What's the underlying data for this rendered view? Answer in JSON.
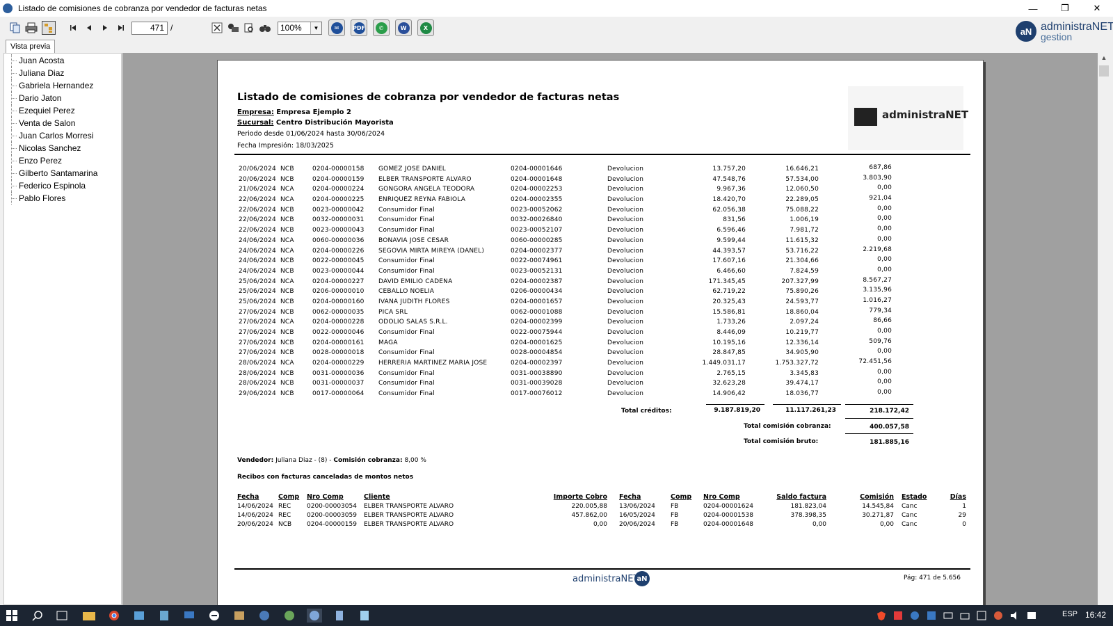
{
  "window": {
    "title": "Listado de comisiones de cobranza por vendedor de facturas netas",
    "minimize": "—",
    "restore": "❐",
    "close": "✕"
  },
  "toolbar": {
    "page_current": "471",
    "page_separator": "/",
    "zoom": "100%",
    "zoom_options": [
      "100%"
    ]
  },
  "brand": {
    "name": "administraNET",
    "sub": "gestion",
    "mark": "aN"
  },
  "tab": {
    "label": "Vista previa"
  },
  "tree": {
    "items": [
      "Juan Acosta",
      "Juliana Diaz",
      "Gabriela Hernandez",
      "Dario Jaton",
      "Ezequiel Perez",
      "Venta de Salon",
      "Juan Carlos Morresi",
      "Nicolas Sanchez",
      "Enzo Perez",
      "Gilberto Santamarina",
      "Federico Espinola",
      "Pablo Flores"
    ]
  },
  "report": {
    "title": "Listado de comisiones de cobranza por vendedor de facturas netas",
    "empresa_label": "Empresa:",
    "empresa_value": " Empresa Ejemplo 2",
    "sucursal_label": "Sucursal:",
    "sucursal_value": " Centro Distribución Mayorista",
    "periodo": "Periodo desde  01/06/2024 hasta 30/06/2024",
    "fecha_impresion": "Fecha Impresión: 18/03/2025",
    "logo_text": "administraNET",
    "rows": [
      [
        "20/06/2024",
        "NCB",
        "0204-00000158",
        "GOMEZ JOSE DANIEL",
        "0204-00001646",
        "Devolucion",
        "13.757,20",
        "16.646,21",
        "687,86"
      ],
      [
        "20/06/2024",
        "NCB",
        "0204-00000159",
        "ELBER TRANSPORTE ALVARO",
        "0204-00001648",
        "Devolucion",
        "47.548,76",
        "57.534,00",
        "3.803,90"
      ],
      [
        "21/06/2024",
        "NCA",
        "0204-00000224",
        "GONGORA ANGELA TEODORA",
        "0204-00002253",
        "Devolucion",
        "9.967,36",
        "12.060,50",
        "0,00"
      ],
      [
        "22/06/2024",
        "NCA",
        "0204-00000225",
        "ENRIQUEZ REYNA FABIOLA",
        "0204-00002355",
        "Devolucion",
        "18.420,70",
        "22.289,05",
        "921,04"
      ],
      [
        "22/06/2024",
        "NCB",
        "0023-00000042",
        "Consumidor Final",
        "0023-00052062",
        "Devolucion",
        "62.056,38",
        "75.088,22",
        "0,00"
      ],
      [
        "22/06/2024",
        "NCB",
        "0032-00000031",
        "Consumidor Final",
        "0032-00026840",
        "Devolucion",
        "831,56",
        "1.006,19",
        "0,00"
      ],
      [
        "22/06/2024",
        "NCB",
        "0023-00000043",
        "Consumidor Final",
        "0023-00052107",
        "Devolucion",
        "6.596,46",
        "7.981,72",
        "0,00"
      ],
      [
        "24/06/2024",
        "NCA",
        "0060-00000036",
        "BONAVIA JOSE CESAR",
        "0060-00000285",
        "Devolucion",
        "9.599,44",
        "11.615,32",
        "0,00"
      ],
      [
        "24/06/2024",
        "NCA",
        "0204-00000226",
        "SEGOVIA MIRTA MIREYA (DANEL)",
        "0204-00002377",
        "Devolucion",
        "44.393,57",
        "53.716,22",
        "2.219,68"
      ],
      [
        "24/06/2024",
        "NCB",
        "0022-00000045",
        "Consumidor Final",
        "0022-00074961",
        "Devolucion",
        "17.607,16",
        "21.304,66",
        "0,00"
      ],
      [
        "24/06/2024",
        "NCB",
        "0023-00000044",
        "Consumidor Final",
        "0023-00052131",
        "Devolucion",
        "6.466,60",
        "7.824,59",
        "0,00"
      ],
      [
        "25/06/2024",
        "NCA",
        "0204-00000227",
        "DAVID EMILIO CADENA",
        "0204-00002387",
        "Devolucion",
        "171.345,45",
        "207.327,99",
        "8.567,27"
      ],
      [
        "25/06/2024",
        "NCB",
        "0206-00000010",
        "CEBALLO NOELIA",
        "0206-00000434",
        "Devolucion",
        "62.719,22",
        "75.890,26",
        "3.135,96"
      ],
      [
        "25/06/2024",
        "NCB",
        "0204-00000160",
        "IVANA JUDITH FLORES",
        "0204-00001657",
        "Devolucion",
        "20.325,43",
        "24.593,77",
        "1.016,27"
      ],
      [
        "27/06/2024",
        "NCB",
        "0062-00000035",
        "PICA SRL",
        "0062-00001088",
        "Devolucion",
        "15.586,81",
        "18.860,04",
        "779,34"
      ],
      [
        "27/06/2024",
        "NCA",
        "0204-00000228",
        "ODOLIO SALAS S.R.L.",
        "0204-00002399",
        "Devolucion",
        "1.733,26",
        "2.097,24",
        "86,66"
      ],
      [
        "27/06/2024",
        "NCB",
        "0022-00000046",
        "Consumidor Final",
        "0022-00075944",
        "Devolucion",
        "8.446,09",
        "10.219,77",
        "0,00"
      ],
      [
        "27/06/2024",
        "NCB",
        "0204-00000161",
        "MAGA",
        "0204-00001625",
        "Devolucion",
        "10.195,16",
        "12.336,14",
        "509,76"
      ],
      [
        "27/06/2024",
        "NCB",
        "0028-00000018",
        "Consumidor Final",
        "0028-00004854",
        "Devolucion",
        "28.847,85",
        "34.905,90",
        "0,00"
      ],
      [
        "28/06/2024",
        "NCA",
        "0204-00000229",
        "HERRERIA MARTINEZ MARIA JOSE",
        "0204-00002397",
        "Devolucion",
        "1.449.031,17",
        "1.753.327,72",
        "72.451,56"
      ],
      [
        "28/06/2024",
        "NCB",
        "0031-00000036",
        "Consumidor Final",
        "0031-00038890",
        "Devolucion",
        "2.765,15",
        "3.345,83",
        "0,00"
      ],
      [
        "28/06/2024",
        "NCB",
        "0031-00000037",
        "Consumidor Final",
        "0031-00039028",
        "Devolucion",
        "32.623,28",
        "39.474,17",
        "0,00"
      ],
      [
        "29/06/2024",
        "NCB",
        "0017-00000064",
        "Consumidor Final",
        "0017-00076012",
        "Devolucion",
        "14.906,42",
        "18.036,77",
        "0,00"
      ]
    ],
    "total_creditos_label": "Total créditos:",
    "total_creditos": [
      "9.187.819,20",
      "11.117.261,23",
      "218.172,42"
    ],
    "total_comision_cobranza_label": "Total comisión cobranza:",
    "total_comision_cobranza": "400.057,58",
    "total_comision_bruto_label": "Total comisión bruto:",
    "total_comision_bruto": "181.885,16",
    "vendedor_label": "Vendedor:",
    "vendedor_value": " Juliana Diaz - (8) - ",
    "comision_label": "Comisión cobranza:",
    "comision_value": " 8,00 %",
    "recibos_title": "Recibos con facturas canceladas de montos netos",
    "recibos_headers": [
      "Fecha",
      "Comp",
      "Nro Comp",
      "Cliente",
      "Importe Cobro",
      "Fecha",
      "Comp",
      "Nro Comp",
      "Saldo factura",
      "Comisión",
      "Estado",
      "Días"
    ],
    "recibos_rows": [
      [
        "14/06/2024",
        "REC",
        "0200-00003054",
        "ELBER TRANSPORTE ALVARO",
        "220.005,88",
        "13/06/2024",
        "FB",
        "0204-00001624",
        "181.823,04",
        "14.545,84",
        "Canc",
        "1"
      ],
      [
        "14/06/2024",
        "REC",
        "0200-00003059",
        "ELBER TRANSPORTE ALVARO",
        "457.862,00",
        "16/05/2024",
        "FB",
        "0204-00001538",
        "378.398,35",
        "30.271,87",
        "Canc",
        "29"
      ],
      [
        "20/06/2024",
        "NCB",
        "0204-00000159",
        "ELBER TRANSPORTE ALVARO",
        "0,00",
        "20/06/2024",
        "FB",
        "0204-00001648",
        "0,00",
        "0,00",
        "Canc",
        "0"
      ]
    ],
    "footer_logo": "administraNET",
    "footer_mark": "aN",
    "pager": "Pág: 471 de 5.656"
  },
  "taskbar": {
    "lang": "ESP",
    "clock": "16:42"
  },
  "colors": {
    "accent": "#1e3f6e",
    "viewer_bg": "#a0a0a0",
    "taskbar": "#1c2532"
  }
}
